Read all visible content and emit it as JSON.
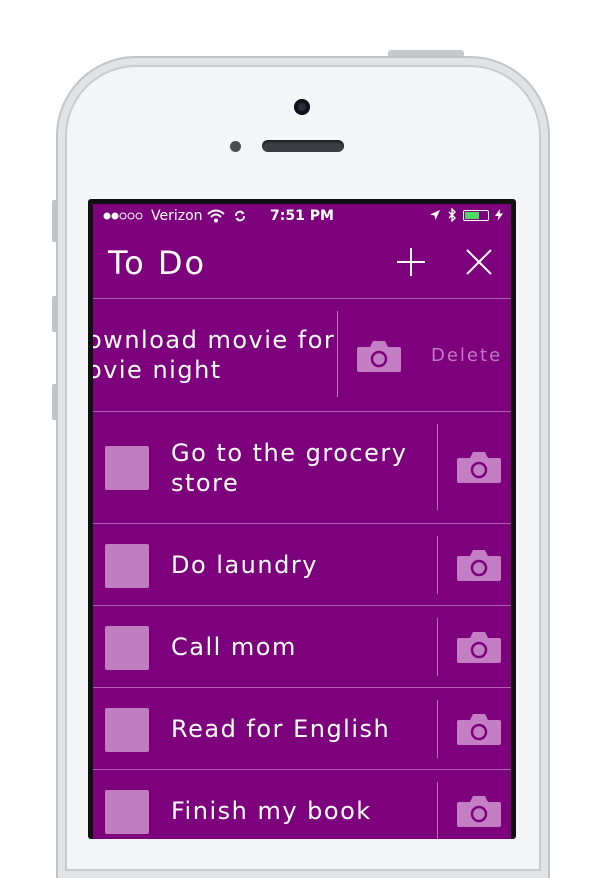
{
  "status_bar": {
    "carrier": "Verizon",
    "time": "7:51 PM"
  },
  "nav": {
    "title": "To Do",
    "add_icon": "plus-icon",
    "close_icon": "close-icon"
  },
  "swiped_item": {
    "line1": "ownload movie for",
    "line2": "ovie night",
    "delete_label": "Delete"
  },
  "items": [
    {
      "line1": "Go to the grocery",
      "line2": "store"
    },
    {
      "line1": "Do laundry"
    },
    {
      "line1": "Call mom"
    },
    {
      "line1": "Read for English"
    },
    {
      "line1": "Finish my book"
    }
  ],
  "colors": {
    "background": "#7d007d",
    "checkbox": "#c07ec0",
    "camera": "#c47fc4",
    "divider": "#b060b0"
  }
}
